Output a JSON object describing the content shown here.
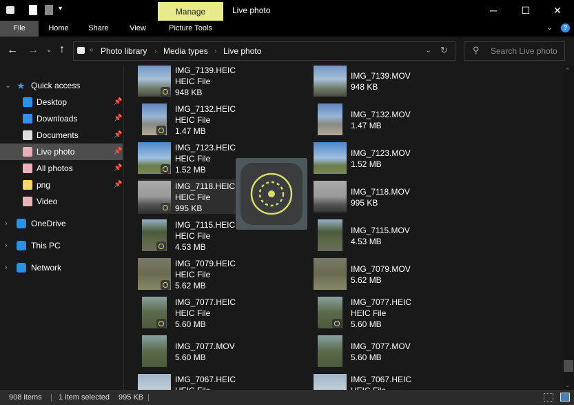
{
  "window": {
    "title": "Live photo",
    "contextual_tab": "Manage",
    "controls": {
      "minimize": "─",
      "maximize": "☐",
      "close": "✕"
    }
  },
  "ribbon": {
    "tabs": [
      "File",
      "Home",
      "Share",
      "View",
      "Picture Tools"
    ]
  },
  "address": {
    "breadcrumb": [
      "Photo library",
      "Media types",
      "Live photo"
    ],
    "overflow": "«",
    "search_placeholder": "Search Live photo"
  },
  "nav": {
    "quick_access": "Quick access",
    "pinned": [
      {
        "label": "Desktop",
        "icon": "desktop-icon",
        "color": "#2d8fe6"
      },
      {
        "label": "Downloads",
        "icon": "download-icon",
        "color": "#3a8ee6"
      },
      {
        "label": "Documents",
        "icon": "document-icon",
        "color": "#ddd"
      },
      {
        "label": "Live photo",
        "icon": "live-photo-icon",
        "color": "#e8b0b8"
      },
      {
        "label": "All photos",
        "icon": "photos-icon",
        "color": "#e8b0b8"
      },
      {
        "label": "png",
        "icon": "folder-icon",
        "color": "#f5d76e"
      },
      {
        "label": "Video",
        "icon": "video-icon",
        "color": "#e8b0b8"
      }
    ],
    "roots": [
      {
        "label": "OneDrive",
        "icon": "cloud-icon"
      },
      {
        "label": "This PC",
        "icon": "computer-icon"
      },
      {
        "label": "Network",
        "icon": "network-icon"
      }
    ],
    "selected": "Live photo"
  },
  "files": {
    "rows": [
      [
        {
          "name": "IMG_7139.HEIC",
          "type": "HEIC File",
          "size": "948 KB",
          "portrait": false
        },
        {
          "name": "IMG_7139.MOV",
          "size": "948 KB",
          "portrait": false
        }
      ],
      [
        {
          "name": "IMG_7132.HEIC",
          "type": "HEIC File",
          "size": "1.47 MB",
          "portrait": true
        },
        {
          "name": "IMG_7132.MOV",
          "size": "1.47 MB",
          "portrait": true
        }
      ],
      [
        {
          "name": "IMG_7123.HEIC",
          "type": "HEIC File",
          "size": "1.52 MB",
          "portrait": false
        },
        {
          "name": "IMG_7123.MOV",
          "size": "1.52 MB",
          "portrait": false
        }
      ],
      [
        {
          "name": "IMG_7118.HEIC",
          "type": "HEIC File",
          "size": "995 KB",
          "portrait": false,
          "selected": true
        },
        {
          "name": "IMG_7118.MOV",
          "size": "995 KB",
          "portrait": false
        }
      ],
      [
        {
          "name": "IMG_7115.HEIC",
          "type": "HEIC File",
          "size": "4.53 MB",
          "portrait": true
        },
        {
          "name": "IMG_7115.MOV",
          "size": "4.53 MB",
          "portrait": true
        }
      ],
      [
        {
          "name": "IMG_7079.HEIC",
          "type": "HEIC File",
          "size": "5.62 MB",
          "portrait": false
        },
        {
          "name": "IMG_7079.MOV",
          "size": "5.62 MB",
          "portrait": false
        }
      ],
      [
        {
          "name": "IMG_7077.HEIC",
          "type": "HEIC File",
          "size": "5.60 MB",
          "portrait": true
        },
        {
          "name": "IMG_7077.HEIC",
          "type": "HEIC File",
          "size": "5.60 MB",
          "portrait": true
        }
      ],
      [
        {
          "name": "IMG_7077.MOV",
          "size": "5.60 MB",
          "portrait": true
        },
        {
          "name": "IMG_7077.MOV",
          "size": "5.60 MB",
          "portrait": true
        }
      ],
      [
        {
          "name": "IMG_7067.HEIC",
          "type": "HEIC File",
          "size": "",
          "portrait": false
        },
        {
          "name": "IMG_7067.HEIC",
          "type": "HEIC File",
          "size": "",
          "portrait": false
        }
      ]
    ]
  },
  "status": {
    "count": "908 items",
    "selection": "1 item selected",
    "size": "995 KB"
  },
  "colors": {
    "accent": "#e8eb8a",
    "live_ring": "#d8dc6a"
  }
}
